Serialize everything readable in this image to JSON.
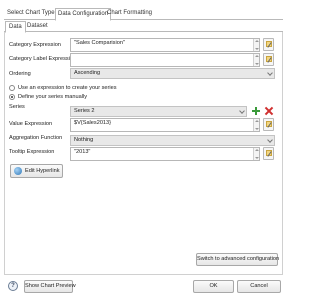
{
  "outer_tabs": [
    {
      "label": "Select Chart Type",
      "active": false
    },
    {
      "label": "Data Configuration",
      "active": true
    },
    {
      "label": "Chart Formatting",
      "active": false
    }
  ],
  "inner_tabs": [
    {
      "label": "Data",
      "active": true
    },
    {
      "label": "Dataset",
      "active": false
    }
  ],
  "form": {
    "category_expression": {
      "label": "Category Expression",
      "value": "\"Sales Comparision\""
    },
    "category_label_expression": {
      "label": "Category Label Expression",
      "value": ""
    },
    "ordering": {
      "label": "Ordering",
      "value": "Ascending"
    },
    "radio_expression": {
      "label": "Use an expression to create your series",
      "selected": false
    },
    "radio_manual": {
      "label": "Define your series manually",
      "selected": true
    },
    "series": {
      "label": "Series",
      "value": "Series 2"
    },
    "value_expression": {
      "label": "Value Expression",
      "value": "$V{Sales2013}"
    },
    "aggregation_function": {
      "label": "Aggregation Function",
      "value": "Nothing"
    },
    "tooltip_expression": {
      "label": "Tooltip Expression",
      "value": "\"2013\""
    }
  },
  "buttons": {
    "edit_hyperlink": "Edit Hyperlink",
    "switch_advanced": "Switch to advanced configuration",
    "show_chart_preview": "Show Chart Preview",
    "ok": "OK",
    "cancel": "Cancel",
    "help": "?"
  },
  "icons": {
    "expression_editor": "pencil-document-icon",
    "add_series": "plus-icon",
    "delete_series": "red-x-icon",
    "hyperlink": "globe-icon"
  },
  "colors": {
    "add": "#3a9a3a",
    "delete": "#d03030",
    "border": "#b7b7b7",
    "disabled_field": "#e8e8e8"
  }
}
